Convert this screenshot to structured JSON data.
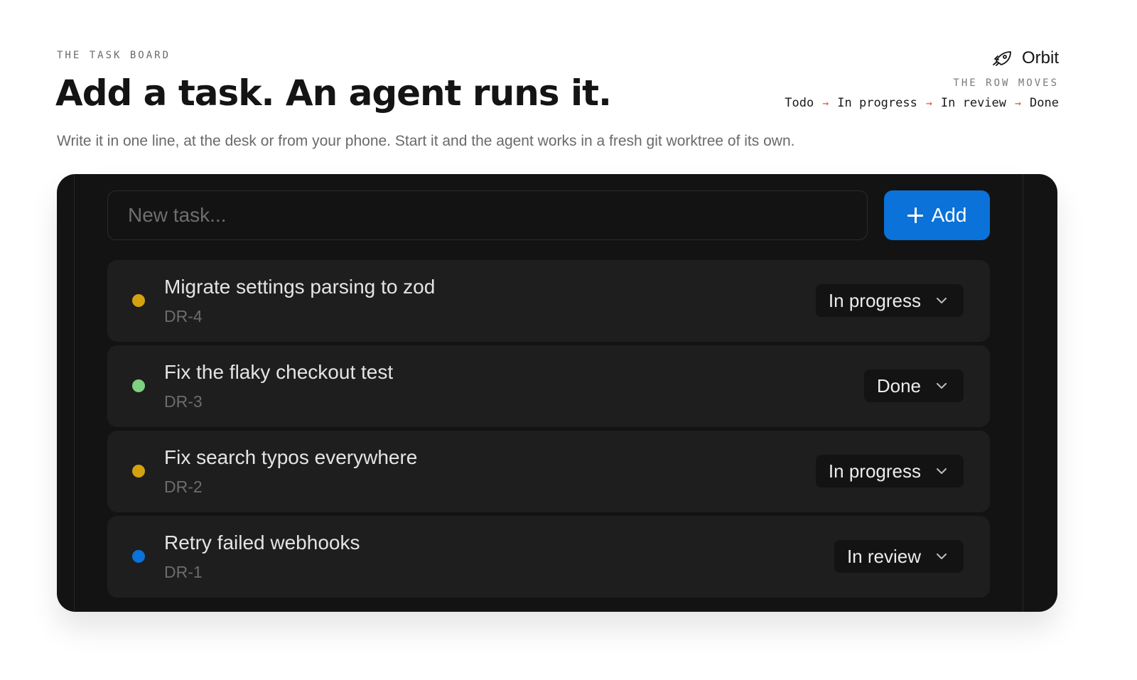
{
  "header": {
    "eyebrow": "THE TASK BOARD",
    "title": "Add a task. An agent runs it.",
    "subtitle": "Write it in one line, at the desk or from your phone. Start it and the agent works in a fresh git worktree of its own."
  },
  "brand": {
    "name": "Orbit",
    "icon": "rocket-icon"
  },
  "flow": {
    "label": "THE ROW MOVES",
    "steps": [
      "Todo",
      "In progress",
      "In review",
      "Done"
    ],
    "arrow": "→",
    "arrow_color": "#e5533d"
  },
  "composer": {
    "placeholder": "New task...",
    "value": "",
    "add_label": "Add",
    "add_color": "#0a72d8"
  },
  "tasks": [
    {
      "title": "Migrate settings parsing to zod",
      "id": "DR-4",
      "status": "In progress",
      "dot_color": "#d4a20e"
    },
    {
      "title": "Fix the flaky checkout test",
      "id": "DR-3",
      "status": "Done",
      "dot_color": "#7ed17e"
    },
    {
      "title": "Fix search typos everywhere",
      "id": "DR-2",
      "status": "In progress",
      "dot_color": "#d4a20e"
    },
    {
      "title": "Retry failed webhooks",
      "id": "DR-1",
      "status": "In review",
      "dot_color": "#0a72d8"
    }
  ]
}
